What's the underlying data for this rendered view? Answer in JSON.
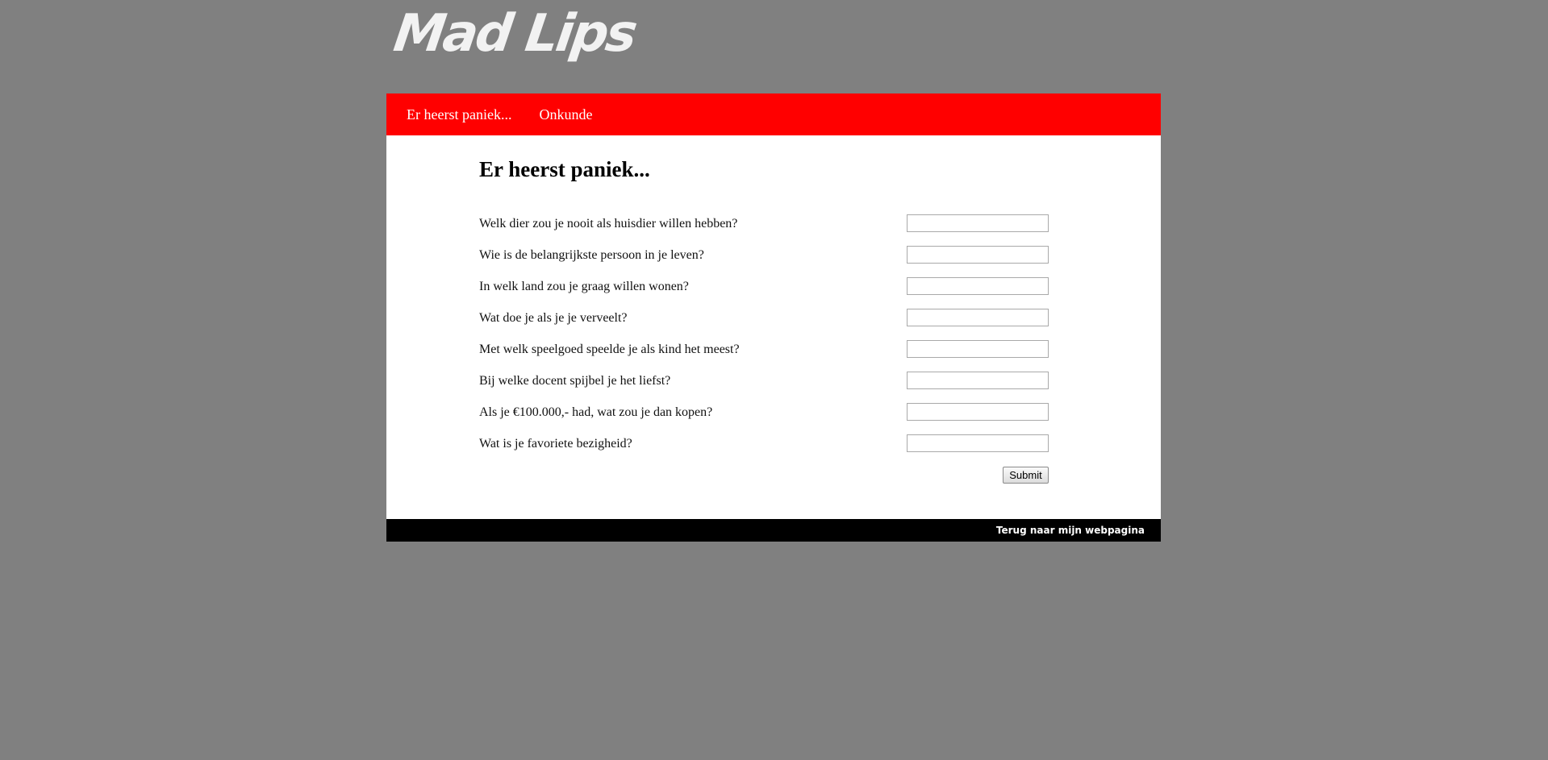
{
  "header": {
    "logo_text": "Mad Lips"
  },
  "nav": {
    "items": [
      {
        "label": "Er heerst paniek..."
      },
      {
        "label": "Onkunde"
      }
    ]
  },
  "main": {
    "title": "Er heerst paniek...",
    "questions": [
      {
        "label": "Welk dier zou je nooit als huisdier willen hebben?",
        "value": ""
      },
      {
        "label": "Wie is de belangrijkste persoon in je leven?",
        "value": ""
      },
      {
        "label": "In welk land zou je graag willen wonen?",
        "value": ""
      },
      {
        "label": "Wat doe je als je je verveelt?",
        "value": ""
      },
      {
        "label": "Met welk speelgoed speelde je als kind het meest?",
        "value": ""
      },
      {
        "label": "Bij welke docent spijbel je het liefst?",
        "value": ""
      },
      {
        "label": "Als je €100.000,- had, wat zou je dan kopen?",
        "value": ""
      },
      {
        "label": "Wat is je favoriete bezigheid?",
        "value": ""
      }
    ],
    "submit_label": "Submit"
  },
  "footer": {
    "link_label": "Terug naar mijn webpagina"
  },
  "colors": {
    "background": "#808080",
    "nav_background": "#ff0000",
    "content_background": "#ffffff",
    "footer_background": "#000000"
  }
}
